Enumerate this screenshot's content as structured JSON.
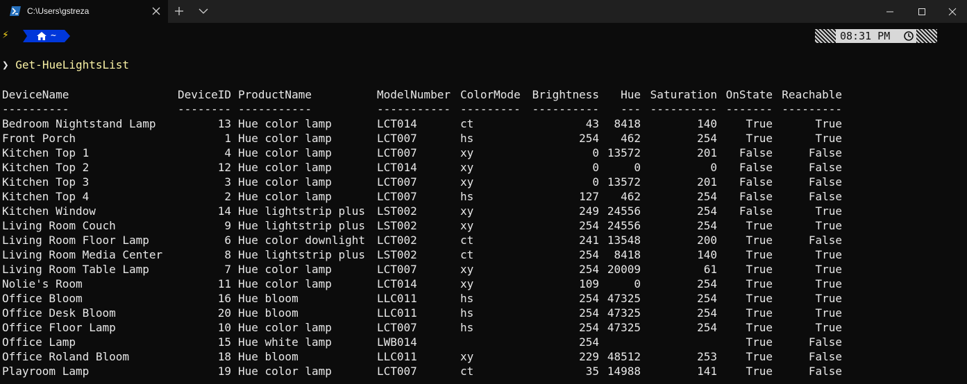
{
  "window": {
    "tab_title": "C:\\Users\\gstreza"
  },
  "prompt": {
    "segment_text": "~",
    "clock_text": "08:31 PM",
    "prompt_symbol": "❯",
    "command": "Get-HueLightsList"
  },
  "table": {
    "headers": [
      "DeviceName",
      "DeviceID",
      "ProductName",
      "ModelNumber",
      "ColorMode",
      "Brightness",
      "Hue",
      "Saturation",
      "OnState",
      "Reachable"
    ],
    "underlines": [
      "----------",
      "--------",
      "-----------",
      "-----------",
      "---------",
      "----------",
      "---",
      "----------",
      "-------",
      "---------"
    ],
    "rows": [
      [
        "Bedroom Nightstand Lamp",
        "13",
        "Hue color lamp",
        "LCT014",
        "ct",
        "43",
        "8418",
        "140",
        "True",
        "True"
      ],
      [
        "Front Porch",
        "1",
        "Hue color lamp",
        "LCT007",
        "hs",
        "254",
        "462",
        "254",
        "True",
        "True"
      ],
      [
        "Kitchen Top 1",
        "4",
        "Hue color lamp",
        "LCT007",
        "xy",
        "0",
        "13572",
        "201",
        "False",
        "False"
      ],
      [
        "Kitchen Top 2",
        "12",
        "Hue color lamp",
        "LCT014",
        "xy",
        "0",
        "0",
        "0",
        "False",
        "False"
      ],
      [
        "Kitchen Top 3",
        "3",
        "Hue color lamp",
        "LCT007",
        "xy",
        "0",
        "13572",
        "201",
        "False",
        "False"
      ],
      [
        "Kitchen Top 4",
        "2",
        "Hue color lamp",
        "LCT007",
        "hs",
        "127",
        "462",
        "254",
        "False",
        "False"
      ],
      [
        "Kitchen Window",
        "14",
        "Hue lightstrip plus",
        "LST002",
        "xy",
        "249",
        "24556",
        "254",
        "False",
        "True"
      ],
      [
        "Living Room Couch",
        "9",
        "Hue lightstrip plus",
        "LST002",
        "xy",
        "254",
        "24556",
        "254",
        "True",
        "True"
      ],
      [
        "Living Room Floor Lamp",
        "6",
        "Hue color downlight",
        "LCT002",
        "ct",
        "241",
        "13548",
        "200",
        "True",
        "False"
      ],
      [
        "Living Room Media Center",
        "8",
        "Hue lightstrip plus",
        "LST002",
        "ct",
        "254",
        "8418",
        "140",
        "True",
        "True"
      ],
      [
        "Living Room Table Lamp",
        "7",
        "Hue color lamp",
        "LCT007",
        "xy",
        "254",
        "20009",
        "61",
        "True",
        "True"
      ],
      [
        "Nolie's Room",
        "11",
        "Hue color lamp",
        "LCT014",
        "xy",
        "109",
        "0",
        "254",
        "True",
        "True"
      ],
      [
        "Office Bloom",
        "16",
        "Hue bloom",
        "LLC011",
        "hs",
        "254",
        "47325",
        "254",
        "True",
        "True"
      ],
      [
        "Office Desk Bloom",
        "20",
        "Hue bloom",
        "LLC011",
        "hs",
        "254",
        "47325",
        "254",
        "True",
        "True"
      ],
      [
        "Office Floor Lamp",
        "10",
        "Hue color lamp",
        "LCT007",
        "hs",
        "254",
        "47325",
        "254",
        "True",
        "True"
      ],
      [
        "Office Lamp",
        "15",
        "Hue white lamp",
        "LWB014",
        "",
        "254",
        "",
        "",
        "True",
        "False"
      ],
      [
        "Office Roland Bloom",
        "18",
        "Hue bloom",
        "LLC011",
        "xy",
        "229",
        "48512",
        "253",
        "True",
        "False"
      ],
      [
        "Playroom Lamp",
        "19",
        "Hue color lamp",
        "LCT007",
        "ct",
        "35",
        "14988",
        "141",
        "True",
        "False"
      ]
    ]
  },
  "colors": {
    "prompt_segment": "#0037da",
    "command_text": "#f9f1a5",
    "bolt": "#f9d71c"
  }
}
